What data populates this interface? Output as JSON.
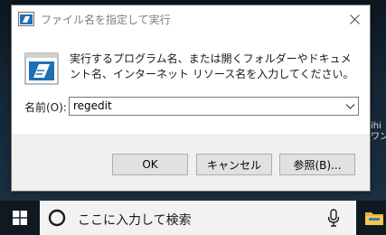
{
  "desktop": {
    "background_snippet": "ihi\nワン"
  },
  "dialog": {
    "title": "ファイル名を指定して実行",
    "description": "実行するプログラム名、または開くフォルダーやドキュメント名、インターネット リソース名を入力してください。",
    "name_label": "名前(O):",
    "input_value": "regedit",
    "buttons": {
      "ok": "OK",
      "cancel": "キャンセル",
      "browse": "参照(B)..."
    }
  },
  "taskbar": {
    "search_placeholder": "ここに入力して検索"
  },
  "icons": {
    "title": "run-icon",
    "big": "run-icon",
    "close": "close-icon",
    "dropdown": "chevron-down-icon",
    "start": "windows-logo-icon",
    "search": "cortana-circle-icon",
    "mic": "microphone-icon",
    "explorer": "folder-icon"
  },
  "colors": {
    "button_strip": "#f0f0f0",
    "taskbar": "#101820",
    "search_box": "#f2f2f2",
    "run_icon_blue": "#1f6fb5"
  }
}
